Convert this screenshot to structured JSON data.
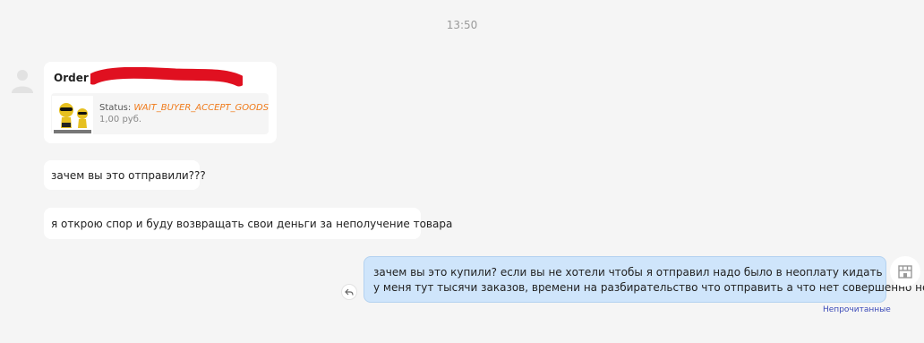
{
  "chat": {
    "timestamp": "13:50",
    "order_card": {
      "title": "Order ID",
      "status_label": "Status:",
      "status_value": "WAIT_BUYER_ACCEPT_GOODS",
      "price": "1,00 руб."
    },
    "incoming_messages": [
      "зачем вы это отправили???",
      "я открою спор и буду возвращать свои деньги за неполучение товара"
    ],
    "outgoing_message": {
      "lines": [
        "зачем вы это купили? если вы не хотели чтобы я отправил надо было в неоплату кидать",
        "у меня тут тысячи заказов, времени на разбирательство что отправить а что нет совершенно нет"
      ],
      "read_status": "Непрочитанные"
    },
    "icons": {
      "user_avatar": "user-avatar-icon",
      "reply": "reply-icon",
      "shop_avatar": "shop-icon"
    },
    "colors": {
      "background": "#f5f5f5",
      "outgoing_bubble": "#cfe5fb",
      "status_value": "#f07a1a",
      "read_status": "#3b4ab8",
      "redaction": "#e01020"
    }
  }
}
